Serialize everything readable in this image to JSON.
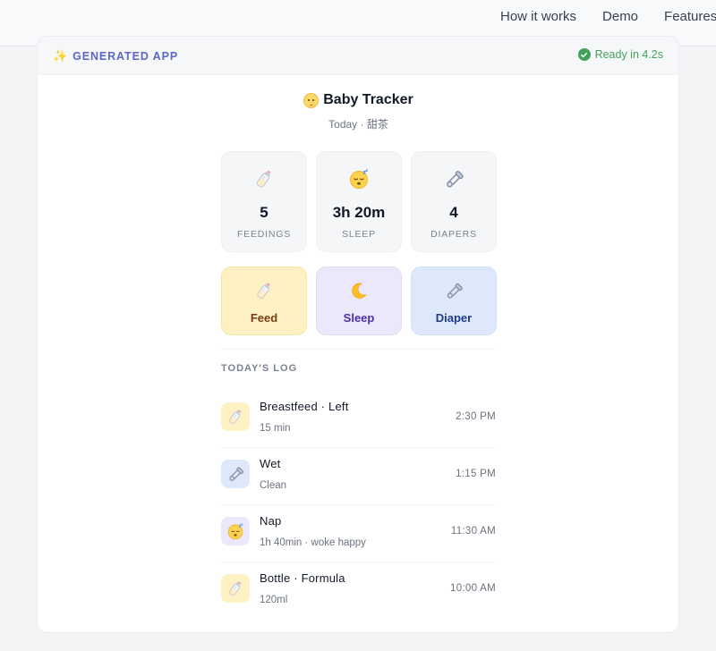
{
  "nav": {
    "links": [
      "How it works",
      "Demo",
      "Features"
    ]
  },
  "frame": {
    "generated_label": "GENERATED APP",
    "ready_label": "Ready in 4.2s"
  },
  "app": {
    "title": "Baby Tracker",
    "subtitle": "Today · 甜茶",
    "stats": [
      {
        "icon": "bottle-icon",
        "value": "5",
        "label": "FEEDINGS"
      },
      {
        "icon": "sleepy-face-icon",
        "value": "3h 20m",
        "label": "SLEEP"
      },
      {
        "icon": "safety-pin-icon",
        "value": "4",
        "label": "DIAPERS"
      }
    ],
    "actions": [
      {
        "icon": "bottle-icon",
        "label": "Feed"
      },
      {
        "icon": "moon-icon",
        "label": "Sleep"
      },
      {
        "icon": "safety-pin-icon",
        "label": "Diaper"
      }
    ],
    "log_title": "TODAY'S LOG",
    "log": [
      {
        "icon": "bottle-icon",
        "name": "Breastfeed · Left",
        "detail": "15 min",
        "time": "2:30 PM"
      },
      {
        "icon": "safety-pin-icon",
        "name": "Wet",
        "detail": "Clean",
        "time": "1:15 PM"
      },
      {
        "icon": "sleepy-face-icon",
        "name": "Nap",
        "detail": "1h 40min · woke happy",
        "time": "11:30 AM"
      },
      {
        "icon": "bottle-icon",
        "name": "Bottle · Formula",
        "detail": "120ml",
        "time": "10:00 AM"
      }
    ]
  },
  "colors": {
    "accent": "#5a67c8",
    "ready_green": "#43a05a",
    "feed_bg": "#fdf1c4",
    "sleep_bg": "#ece8fb",
    "diaper_bg": "#dde9fb"
  }
}
